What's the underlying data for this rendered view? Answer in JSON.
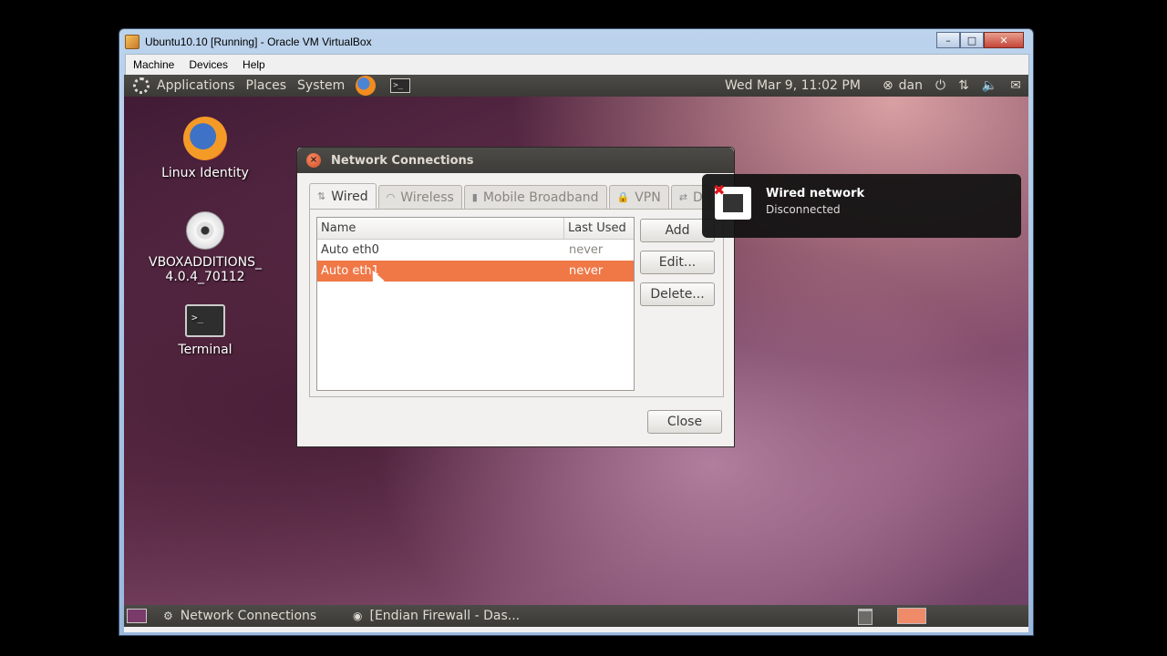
{
  "host": {
    "title": "Ubuntu10.10 [Running] - Oracle VM VirtualBox",
    "menu": [
      "Machine",
      "Devices",
      "Help"
    ],
    "buttons": {
      "minimize": "–",
      "maximize": "□",
      "close": "✕"
    }
  },
  "top_panel": {
    "menu": [
      "Applications",
      "Places",
      "System"
    ],
    "clock": "Wed Mar  9, 11:02 PM",
    "user": "dan"
  },
  "desktop_icons": [
    {
      "label": "Linux Identity"
    },
    {
      "label": "VBOXADDITIONS_\n4.0.4_70112"
    },
    {
      "label": "Terminal"
    }
  ],
  "dialog": {
    "title": "Network Connections",
    "tabs": [
      "Wired",
      "Wireless",
      "Mobile Broadband",
      "VPN",
      "D"
    ],
    "columns": [
      "Name",
      "Last Used"
    ],
    "rows": [
      {
        "name": "Auto eth0",
        "last_used": "never"
      },
      {
        "name": "Auto eth1",
        "last_used": "never"
      }
    ],
    "buttons": {
      "add": "Add",
      "edit": "Edit...",
      "delete": "Delete...",
      "close": "Close"
    },
    "selected_color": "#f07746"
  },
  "notification": {
    "title": "Wired network",
    "body": "Disconnected"
  },
  "bottom_panel": {
    "tasks": [
      "Network Connections",
      "[Endian Firewall - Das..."
    ]
  },
  "colors": {
    "panel": "#3f3e3a",
    "accent": "#f07746"
  }
}
